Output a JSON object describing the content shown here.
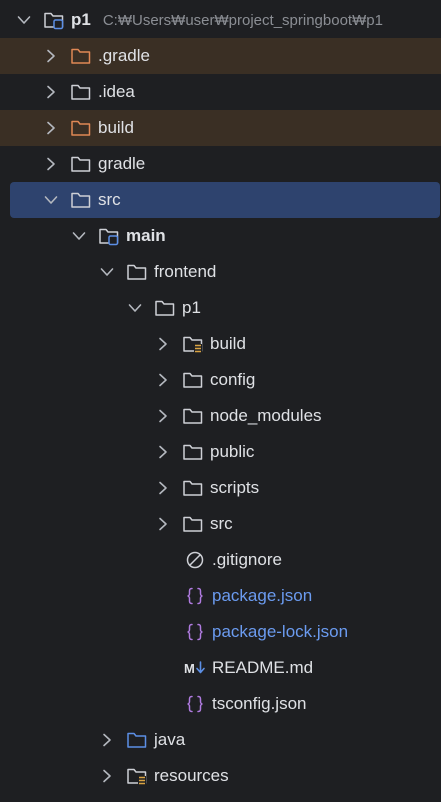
{
  "project": {
    "name": "p1",
    "path": "C:₩Users₩user₩project_springboot₩p1"
  },
  "items": [
    {
      "label": ".gradle"
    },
    {
      "label": ".idea"
    },
    {
      "label": "build"
    },
    {
      "label": "gradle"
    },
    {
      "label": "src"
    },
    {
      "label": "main"
    },
    {
      "label": "frontend"
    },
    {
      "label": "p1"
    },
    {
      "label": "build"
    },
    {
      "label": "config"
    },
    {
      "label": "node_modules"
    },
    {
      "label": "public"
    },
    {
      "label": "scripts"
    },
    {
      "label": "src"
    },
    {
      "label": ".gitignore"
    },
    {
      "label": "package.json"
    },
    {
      "label": "package-lock.json"
    },
    {
      "label": "README.md"
    },
    {
      "label": "tsconfig.json"
    },
    {
      "label": "java"
    },
    {
      "label": "resources"
    }
  ],
  "icons": {
    "chevron_right": "chevron-right-icon",
    "chevron_down": "chevron-down-icon",
    "folder": "folder-icon",
    "folder_excluded": "folder-excluded-icon",
    "folder_module": "folder-module-icon",
    "folder_source": "folder-source-icon",
    "folder_resources": "folder-resources-icon",
    "gitignore": "ignore-file-icon",
    "json": "json-file-icon",
    "markdown": "markdown-file-icon"
  },
  "colors": {
    "background": "#1e1f22",
    "selection": "#2e436e",
    "excluded_row": "#3a2f24",
    "excluded_folder": "#e08855",
    "source_folder": "#5c8fe6",
    "json_text": "#6b9bf0",
    "json_icon": "#b07be0"
  }
}
